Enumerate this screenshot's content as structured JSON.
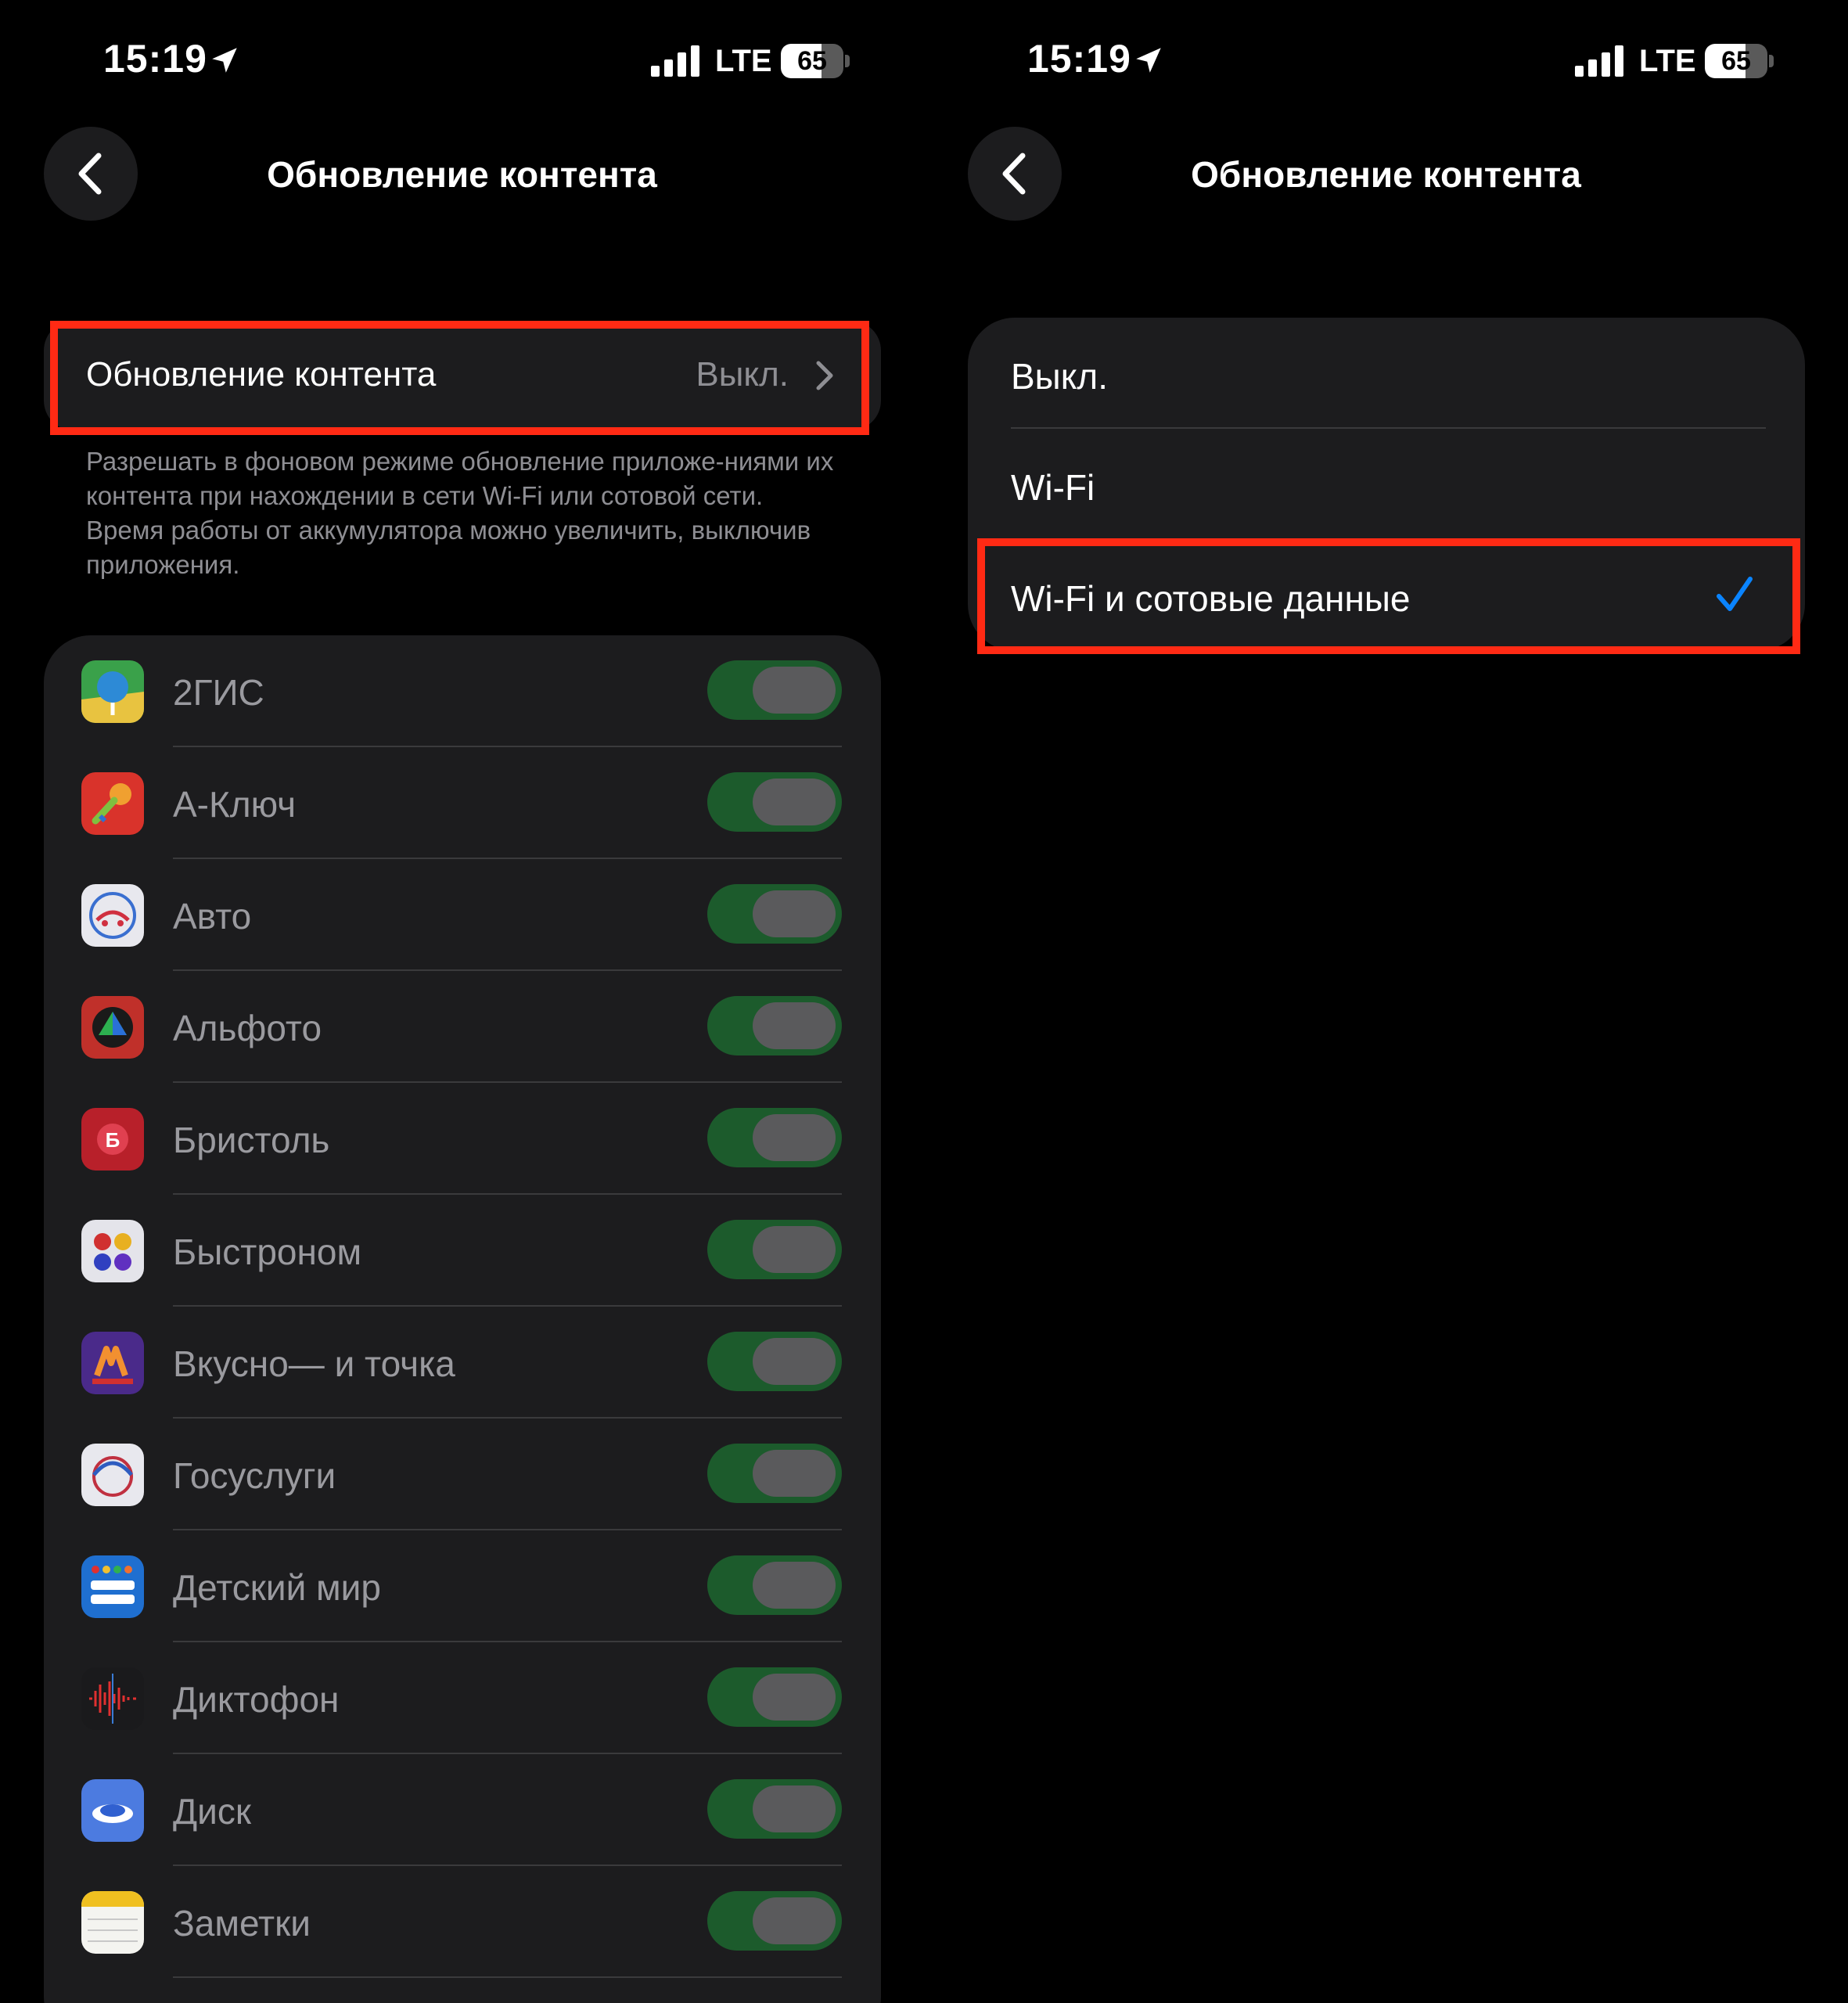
{
  "status_bar": {
    "time": "15:19",
    "network": "LTE",
    "battery": "65",
    "battery_level": 0.65
  },
  "left_screen": {
    "nav_title": "Обновление контента",
    "setting": {
      "label": "Обновление контента",
      "value": "Выкл."
    },
    "footnote": "Разрешать в фоновом режиме обновление приложе-ниями их контента при нахождении в сети Wi-Fi или сотовой сети. Время работы от аккумулятора можно увеличить, выключив приложения.",
    "apps": [
      {
        "name": "2ГИС",
        "icon": "2gis-icon",
        "enabled": true
      },
      {
        "name": "А-Ключ",
        "icon": "a-key-icon",
        "enabled": true
      },
      {
        "name": "Авто",
        "icon": "auto-icon",
        "enabled": true
      },
      {
        "name": "Альфото",
        "icon": "alfoto-icon",
        "enabled": true
      },
      {
        "name": "Бристоль",
        "icon": "bristol-icon",
        "enabled": true
      },
      {
        "name": "Быстроном",
        "icon": "bystronom-icon",
        "enabled": true
      },
      {
        "name": "Вкусно— и точка",
        "icon": "vkusno-icon",
        "enabled": true
      },
      {
        "name": "Госуслуги",
        "icon": "gosuslugi-icon",
        "enabled": true
      },
      {
        "name": "Детский мир",
        "icon": "detsky-mir-icon",
        "enabled": true
      },
      {
        "name": "Диктофон",
        "icon": "voice-memos-icon",
        "enabled": true
      },
      {
        "name": "Диск",
        "icon": "disk-icon",
        "enabled": true
      },
      {
        "name": "Заметки",
        "icon": "notes-icon",
        "enabled": true
      }
    ]
  },
  "right_screen": {
    "nav_title": "Обновление контента",
    "options": [
      {
        "label": "Выкл.",
        "selected": false
      },
      {
        "label": "Wi-Fi",
        "selected": false
      },
      {
        "label": "Wi-Fi и сотовые данные",
        "selected": true
      }
    ]
  },
  "colors": {
    "background": "#000000",
    "card": "#1c1c1e",
    "highlight": "#ff2a14",
    "toggle_on": "#1c5b2c",
    "checkmark": "#0a84ff",
    "secondary_text": "#8e8e93"
  }
}
